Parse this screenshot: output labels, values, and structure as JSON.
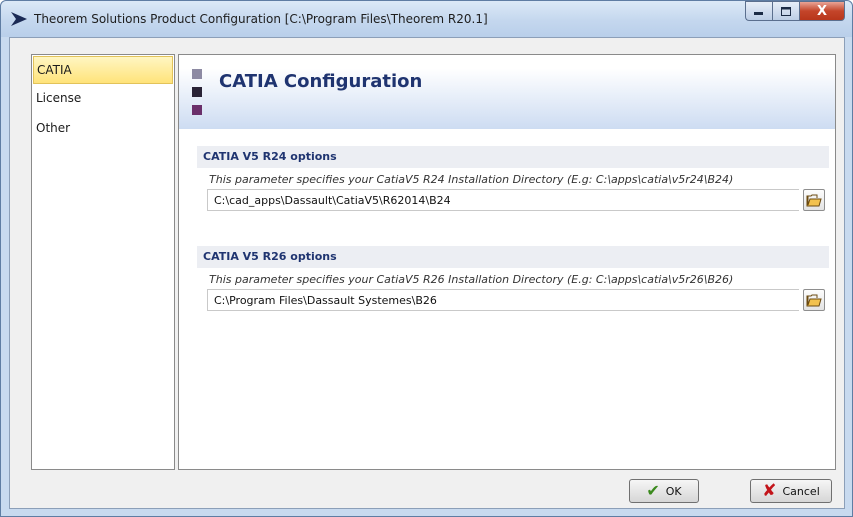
{
  "window": {
    "title": "Theorem Solutions Product Configuration [C:\\Program Files\\Theorem R20.1]",
    "close_symbol": "X"
  },
  "nav": {
    "items": [
      {
        "label": "CATIA",
        "selected": true
      },
      {
        "label": "License",
        "selected": false
      },
      {
        "label": "Other",
        "selected": false
      }
    ]
  },
  "content": {
    "header_title": "CATIA Configuration",
    "sections": [
      {
        "title": "CATIA V5 R24 options",
        "description": "This parameter specifies your CatiaV5 R24 Installation Directory (E.g: C:\\apps\\catia\\v5r24\\B24)",
        "value": "C:\\cad_apps\\Dassault\\CatiaV5\\R62014\\B24"
      },
      {
        "title": "CATIA V5 R26 options",
        "description": "This parameter specifies your CatiaV5 R26 Installation Directory (E.g: C:\\apps\\catia\\v5r26\\B26)",
        "value": "C:\\Program Files\\Dassault Systemes\\B26"
      }
    ]
  },
  "buttons": {
    "ok_label": "OK",
    "cancel_label": "Cancel"
  },
  "colors": {
    "header_title": "#1f3470",
    "selected_nav": "#ffe37a",
    "ok_icon": "#3b8a1e",
    "cancel_icon": "#c3141a"
  },
  "icons": {
    "app": "chevron-right-icon",
    "browse": "open-folder-icon",
    "ok": "checkmark-icon",
    "cancel": "x-icon"
  }
}
